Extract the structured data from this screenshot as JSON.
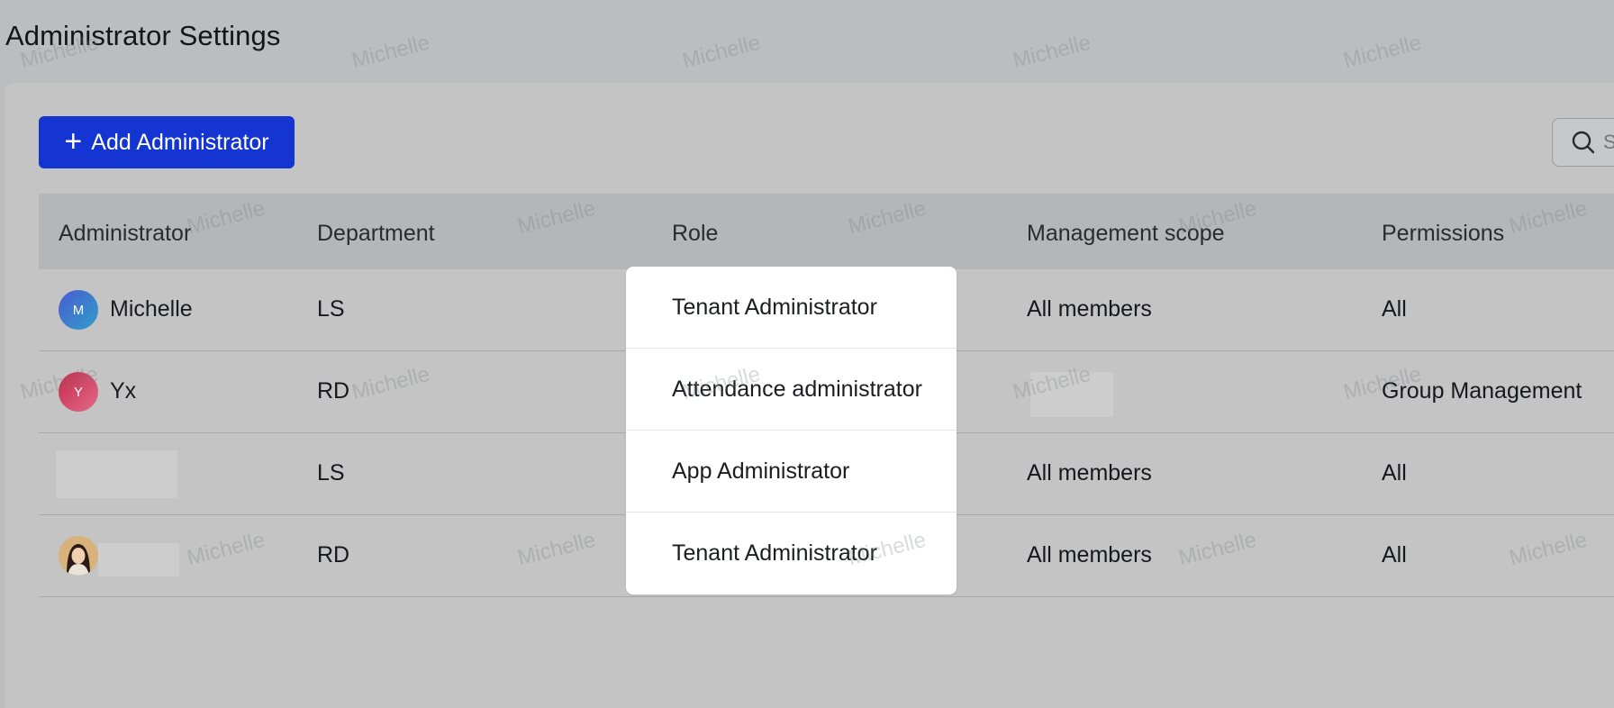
{
  "page": {
    "title": "Administrator Settings"
  },
  "toolbar": {
    "add_label": "Add Administrator",
    "search_placeholder": "S"
  },
  "table": {
    "columns": {
      "administrator": "Administrator",
      "department": "Department",
      "role": "Role",
      "management_scope": "Management scope",
      "permissions": "Permissions"
    },
    "rows": [
      {
        "avatar_initial": "M",
        "name": "Michelle",
        "department": "LS",
        "role": "Tenant Administrator",
        "scope": "All members",
        "permissions": "All"
      },
      {
        "avatar_initial": "Y",
        "name": "Yx",
        "department": "RD",
        "role": "Attendance administrator",
        "scope": "",
        "permissions": "Group Management"
      },
      {
        "avatar_initial": "",
        "name": "",
        "department": "LS",
        "role": "App Administrator",
        "scope": "All members",
        "permissions": "All"
      },
      {
        "avatar_initial": "",
        "name": "",
        "department": "RD",
        "role": "Tenant Administrator",
        "scope": "All members",
        "permissions": "All"
      }
    ]
  },
  "watermark": {
    "text": "Michelle"
  },
  "colors": {
    "accent": "#1435d1",
    "popover_bg": "#ffffff"
  }
}
